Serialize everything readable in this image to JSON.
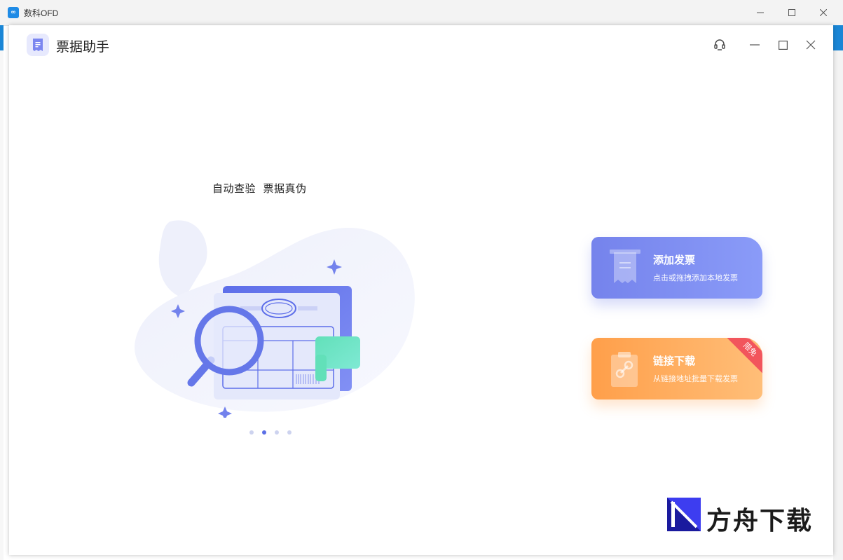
{
  "os_window": {
    "title": "数科OFD",
    "app_icon": "infinity-icon",
    "controls": [
      "minimize-icon",
      "maximize-icon",
      "close-icon"
    ]
  },
  "app": {
    "title": "票据助手",
    "logo_icon": "receipt-icon",
    "controls": [
      "customer-service-icon",
      "minimize-icon",
      "maximize-icon",
      "close-icon"
    ]
  },
  "carousel": {
    "slogan": "自动查验  票据真伪",
    "illustration": "invoice-magnifier-illustration",
    "slide_count": 4,
    "active_index": 1
  },
  "actions": {
    "add_invoice": {
      "title": "添加发票",
      "description": "点击或拖拽添加本地发票",
      "icon": "receipt-icon",
      "color": "#7583ec"
    },
    "link_download": {
      "title": "链接下载",
      "description": "从链接地址批量下载发票",
      "icon": "clipboard-link-icon",
      "badge": "限免",
      "color": "#ff9f4a"
    }
  },
  "watermark": {
    "text": "方舟下载"
  }
}
